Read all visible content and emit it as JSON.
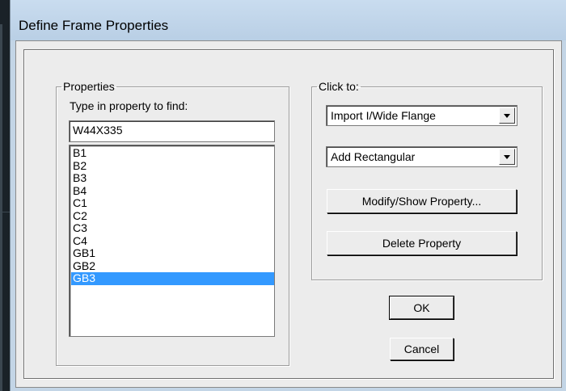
{
  "window": {
    "title": "Define Frame Properties"
  },
  "properties": {
    "group_label": "Properties",
    "find_label": "Type in property to find:",
    "find_value": "W44X335",
    "items": [
      "B1",
      "B2",
      "B3",
      "B4",
      "C1",
      "C2",
      "C3",
      "C4",
      "GB1",
      "GB2",
      "GB3"
    ],
    "selected": "GB3"
  },
  "click_to": {
    "group_label": "Click to:",
    "import_combo": "Import I/Wide Flange",
    "add_combo": "Add Rectangular",
    "modify_button": "Modify/Show Property...",
    "delete_button": "Delete Property"
  },
  "actions": {
    "ok": "OK",
    "cancel": "Cancel"
  },
  "colors": {
    "selection": "#3399ff",
    "dialog_bg": "#ececec",
    "title_bg": "#c3d5e6"
  }
}
